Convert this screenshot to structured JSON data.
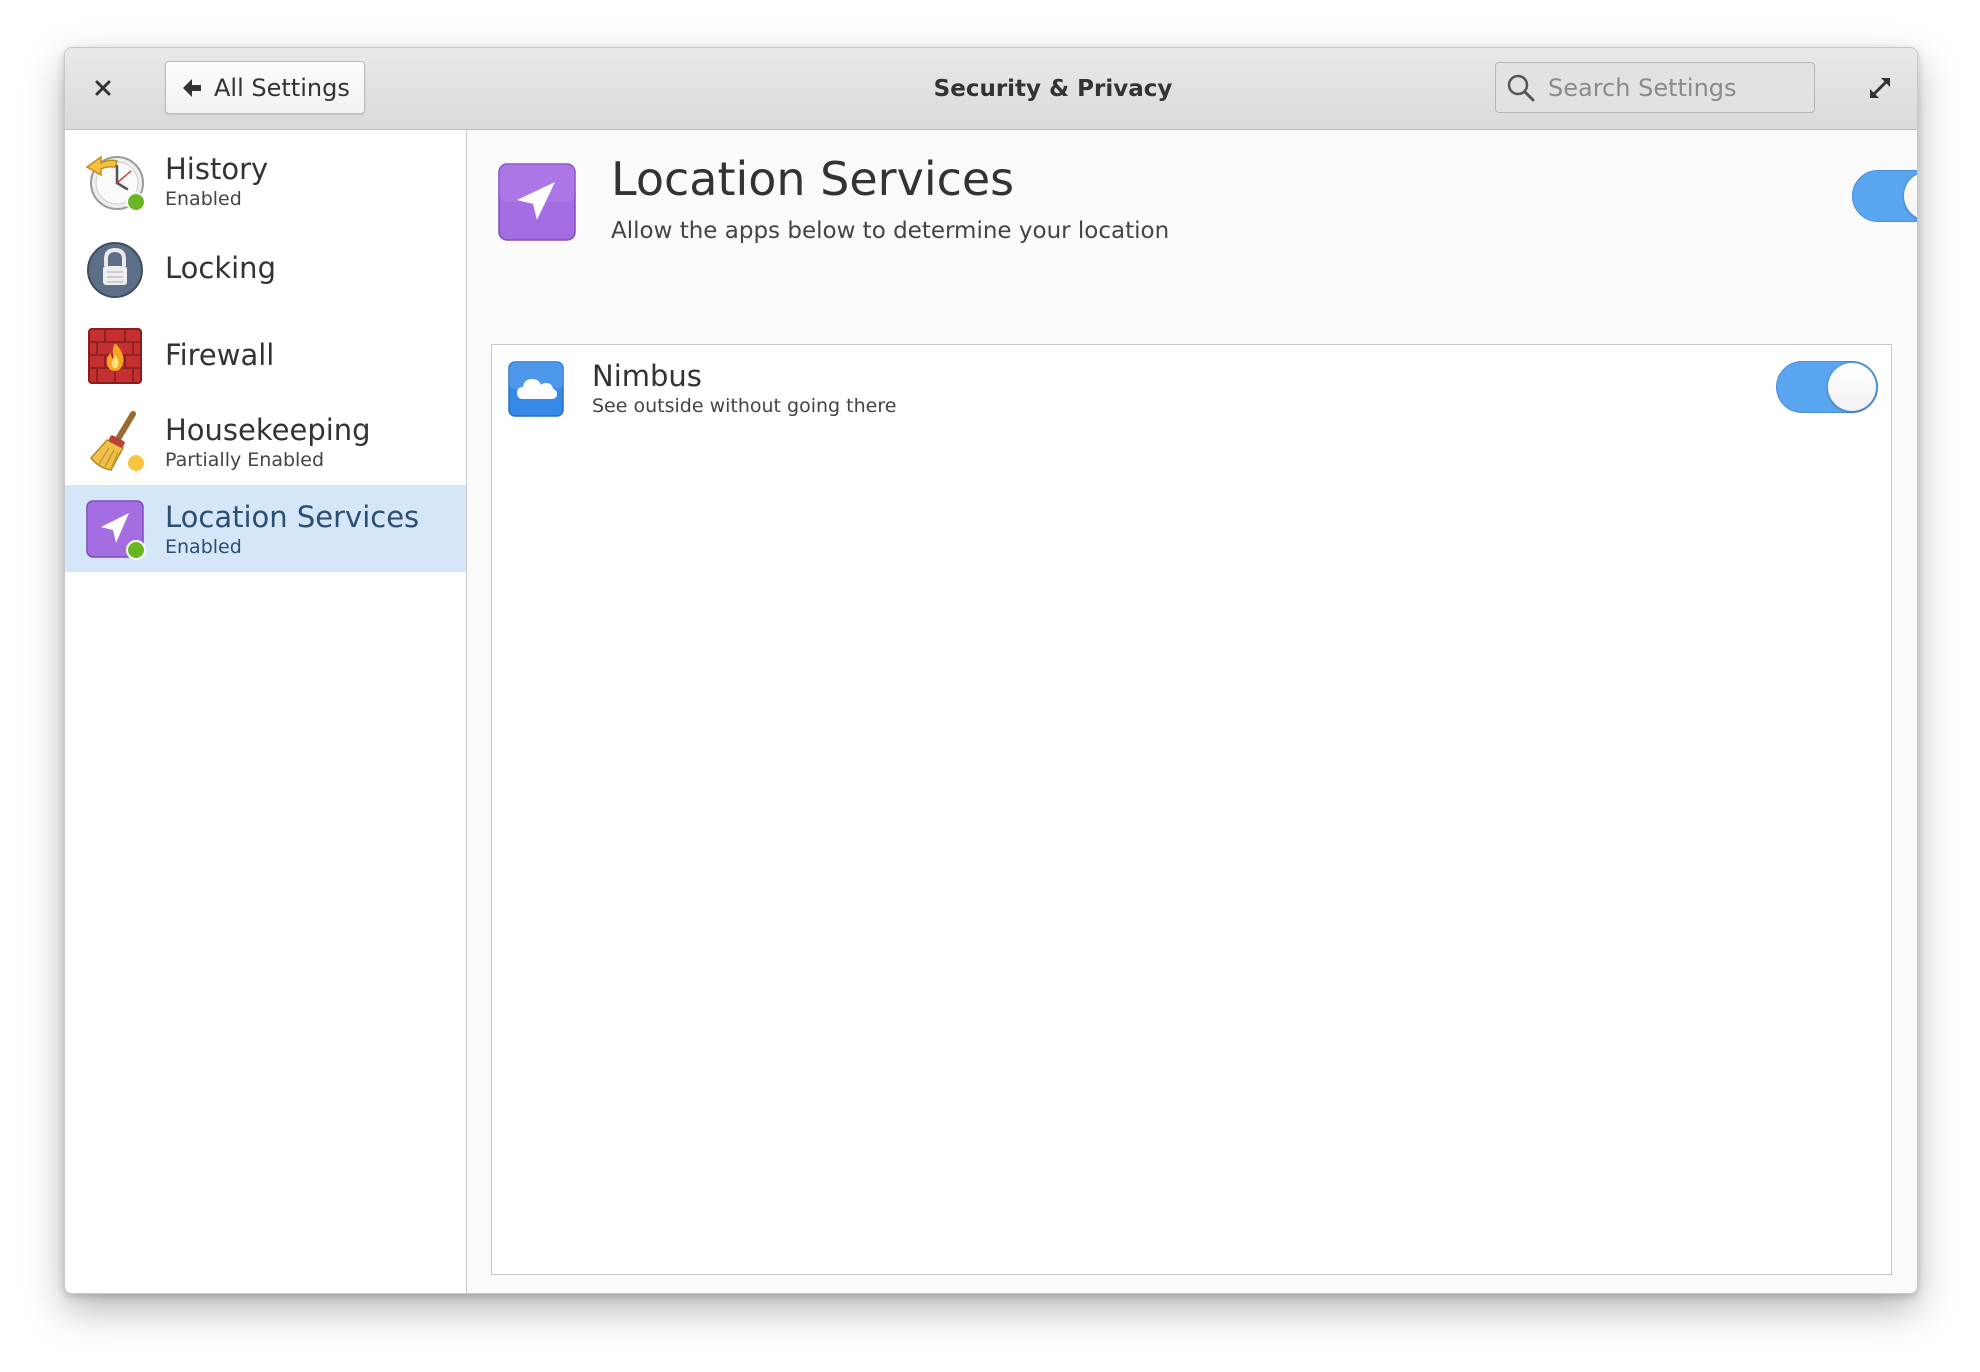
{
  "window": {
    "title": "Security & Privacy",
    "back_label": "All Settings",
    "search_placeholder": "Search Settings"
  },
  "sidebar": {
    "items": [
      {
        "label": "History",
        "status": "Enabled",
        "icon": "history-clock-icon"
      },
      {
        "label": "Locking",
        "status": "",
        "icon": "padlock-icon"
      },
      {
        "label": "Firewall",
        "status": "",
        "icon": "firewall-brick-icon"
      },
      {
        "label": "Housekeeping",
        "status": "Partially Enabled",
        "icon": "broom-icon"
      },
      {
        "label": "Location Services",
        "status": "Enabled",
        "icon": "location-arrow-icon",
        "selected": true
      }
    ]
  },
  "content": {
    "title": "Location Services",
    "description": "Allow the apps below to determine your location",
    "enabled": true,
    "apps": [
      {
        "name": "Nimbus",
        "description": "See outside without going there",
        "icon": "cloud-icon",
        "enabled": true
      }
    ]
  },
  "colors": {
    "accent": "#5aa5ef",
    "selected_row": "#d4e6f8",
    "status_green": "#68b723",
    "location_purple": "#a56de2"
  }
}
